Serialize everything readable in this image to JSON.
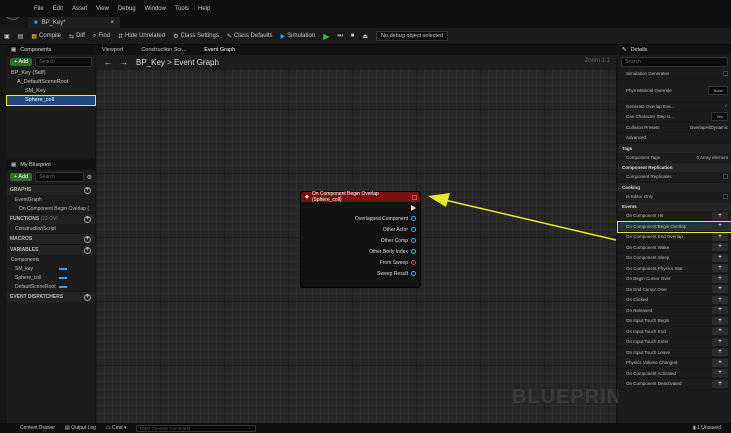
{
  "window": {
    "title": "BP_Key*"
  },
  "menu": [
    "File",
    "Edit",
    "Asset",
    "View",
    "Debug",
    "Window",
    "Tools",
    "Help"
  ],
  "toolbar": {
    "compile": "Compile",
    "diff": "Diff",
    "find": "Find",
    "hide_unrelated": "Hide Unrelated",
    "class_settings": "Class Settings",
    "class_defaults": "Class Defaults",
    "simulation": "Simulation",
    "debug_object": "No debug object selected"
  },
  "components": {
    "tab": "Components",
    "add": "+ Add",
    "search_placeholder": "Search",
    "items": [
      "BP_Key (Self)",
      "A_DefaultSceneRoot",
      "SM_Key",
      "Sphere_coll"
    ]
  },
  "my_blueprint": {
    "tab": "My Blueprint",
    "add": "+ Add",
    "search_placeholder": "Search",
    "sections": {
      "graphs": "GRAPHS",
      "event_graph": "EventGraph",
      "event_item": "On Component Begin Overlap (",
      "functions": "FUNCTIONS",
      "functions_count": "(22 OVI",
      "construction": "ConstructionScript",
      "macros": "MACROS",
      "variables": "VARIABLES",
      "components_cat": "Components",
      "var_items": [
        "SM_key",
        "Sphere_coll",
        "DefaultSceneRoot"
      ],
      "dispatchers": "EVENT DISPATCHERS"
    }
  },
  "graph": {
    "tabs": [
      "Viewport",
      "Construction Scr...",
      "Event Graph"
    ],
    "breadcrumb": "BP_Key > Event Graph",
    "zoom": "Zoom 1:1",
    "watermark": "BLUEPRINT",
    "node": {
      "title": "On Component Begin Overlap (Sphere_coll)",
      "pins": [
        "Overlapped Component",
        "Other Actor",
        "Other Comp",
        "Other Body Index",
        "From Sweep",
        "Sweep Result"
      ]
    }
  },
  "details": {
    "tab": "Details",
    "search_placeholder": "Search",
    "rows": [
      {
        "label": "Simulation Generates",
        "value": ""
      },
      {
        "label": "Phys Material Override",
        "value": "None"
      },
      {
        "label": "Generate Overlap Eve...",
        "value": ""
      },
      {
        "label": "Can Character Step U...",
        "value": "Yes"
      },
      {
        "label": "Collision Presets",
        "value": "OverlapAllDynamic"
      },
      {
        "label": "Advanced",
        "value": ""
      }
    ],
    "tags_section": "Tags",
    "component_tags": "Component Tags",
    "component_tags_value": "0 Array element",
    "replication_section": "Component Replication",
    "replicates": "Component Replicates",
    "cooking_section": "Cooking",
    "editor_only": "Is Editor Only",
    "events_section": "Events",
    "events": [
      "On Component Hit",
      "On Component Begin Overlap",
      "On Component End Overlap",
      "On Component Wake",
      "On Component Sleep",
      "On Component Physics Stat",
      "On Begin Cursor Over",
      "On End Cursor Over",
      "On Clicked",
      "On Released",
      "On Input Touch Begin",
      "On Input Touch End",
      "On Input Touch Enter",
      "On Input Touch Leave",
      "Physics Volume Changed",
      "On Component Activated",
      "On Component Deactivated"
    ]
  },
  "status": {
    "content_drawer": "Content Drawer",
    "output_log": "Output Log",
    "cmd": "Cmd",
    "console_placeholder": "Enter Console Command",
    "unsaved": "1 Unsaved"
  }
}
